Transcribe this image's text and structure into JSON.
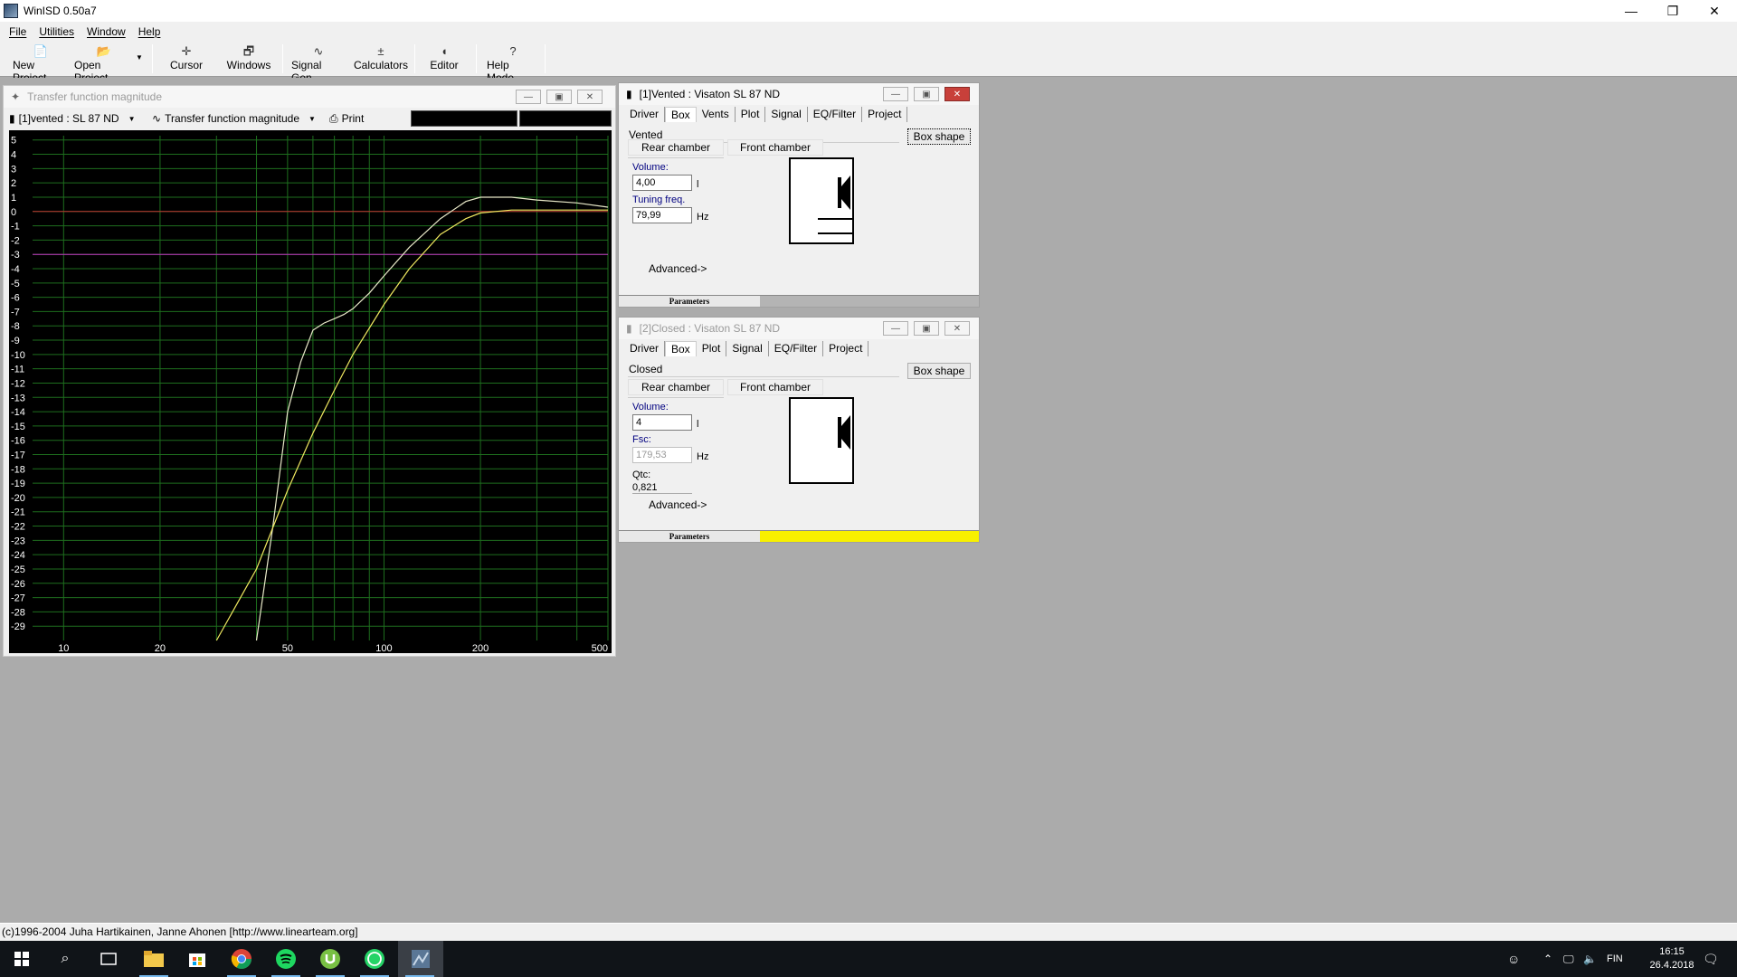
{
  "window": {
    "title": "WinISD 0.50a7",
    "min": "—",
    "max": "❐",
    "close": "✕"
  },
  "menu": [
    "File",
    "Utilities",
    "Window",
    "Help"
  ],
  "toolbar": [
    {
      "name": "new-project-button",
      "label": "New Project",
      "icon": "📄"
    },
    {
      "name": "open-project-button",
      "label": "Open Project",
      "icon": "📂"
    },
    {
      "name": "cursor-button",
      "label": "Cursor",
      "icon": "✛"
    },
    {
      "name": "windows-button",
      "label": "Windows",
      "icon": "🗗"
    },
    {
      "name": "signal-gen-button",
      "label": "Signal Gen.",
      "icon": "∿"
    },
    {
      "name": "calculators-button",
      "label": "Calculators",
      "icon": "±"
    },
    {
      "name": "editor-button",
      "label": "Editor",
      "icon": "◖"
    },
    {
      "name": "help-mode-button",
      "label": "Help Mode",
      "icon": "?"
    }
  ],
  "graph_window": {
    "title": "Transfer function magnitude",
    "project_select": "[1]vented : SL 87 ND",
    "graph_type_select": "Transfer function magnitude",
    "print_label": "Print"
  },
  "chart_data": {
    "type": "line",
    "title": "",
    "xlabel": "",
    "ylabel": "",
    "x_scale": "log",
    "xlim": [
      8,
      500
    ],
    "ylim": [
      -30,
      5
    ],
    "x_ticks": [
      10,
      20,
      50,
      100,
      200,
      500
    ],
    "y_ticks": [
      5,
      4,
      3,
      2,
      1,
      0,
      -1,
      -2,
      -3,
      -4,
      -5,
      -6,
      -7,
      -8,
      -9,
      -10,
      -11,
      -12,
      -13,
      -14,
      -15,
      -16,
      -17,
      -18,
      -19,
      -20,
      -21,
      -22,
      -23,
      -24,
      -25,
      -26,
      -27,
      -28,
      -29
    ],
    "grid": true,
    "reference_lines": [
      {
        "y": 0,
        "color": "#c03030"
      },
      {
        "y": -3,
        "color": "#c030c0"
      }
    ],
    "series": [
      {
        "color": "#e8e8c8",
        "x": [
          40,
          45,
          50,
          55,
          60,
          65,
          70,
          75,
          80,
          90,
          100,
          120,
          150,
          180,
          200,
          250,
          300,
          400,
          500
        ],
        "y": [
          -30,
          -22,
          -14,
          -10.5,
          -8.3,
          -7.8,
          -7.5,
          -7.2,
          -6.8,
          -5.7,
          -4.5,
          -2.5,
          -0.5,
          0.7,
          1.0,
          1.0,
          0.8,
          0.6,
          0.3
        ]
      },
      {
        "color": "#f0e860",
        "x": [
          30,
          40,
          50,
          60,
          70,
          80,
          100,
          120,
          150,
          180,
          200,
          250,
          300,
          400,
          500
        ],
        "y": [
          -30,
          -25,
          -19.5,
          -15.5,
          -12.5,
          -10,
          -6.5,
          -4,
          -1.6,
          -0.5,
          -0.1,
          0.1,
          0.1,
          0.1,
          0.1
        ]
      }
    ]
  },
  "vented_window": {
    "title": "[1]Vented : Visaton SL 87 ND",
    "tabs": [
      "Driver",
      "Box",
      "Vents",
      "Plot",
      "Signal",
      "EQ/Filter",
      "Project"
    ],
    "box_type": "Vented",
    "box_shape_label": "Box shape",
    "rear_chamber": "Rear chamber",
    "front_chamber": "Front chamber",
    "volume_label": "Volume:",
    "volume_value": "4,00",
    "volume_unit": "l",
    "tuning_label": "Tuning freq.",
    "tuning_value": "79,99",
    "tuning_unit": "Hz",
    "advanced": "Advanced->",
    "parameters": "Parameters",
    "parameters_color": "#b4b4b4"
  },
  "closed_window": {
    "title": "[2]Closed : Visaton SL 87 ND",
    "tabs": [
      "Driver",
      "Box",
      "Plot",
      "Signal",
      "EQ/Filter",
      "Project"
    ],
    "box_type": "Closed",
    "box_shape_label": "Box shape",
    "rear_chamber": "Rear chamber",
    "front_chamber": "Front chamber",
    "volume_label": "Volume:",
    "volume_value": "4",
    "volume_unit": "l",
    "fsc_label": "Fsc:",
    "fsc_value": "179,53",
    "fsc_unit": "Hz",
    "qtc_label": "Qtc:",
    "qtc_value": "0,821",
    "advanced": "Advanced->",
    "parameters": "Parameters",
    "parameters_color": "#f8f000"
  },
  "statusbar": "(c)1996-2004 Juha Hartikainen, Janne Ahonen [http://www.linearteam.org]",
  "taskbar": {
    "language": "FIN",
    "time": "16:15",
    "date": "26.4.2018"
  }
}
